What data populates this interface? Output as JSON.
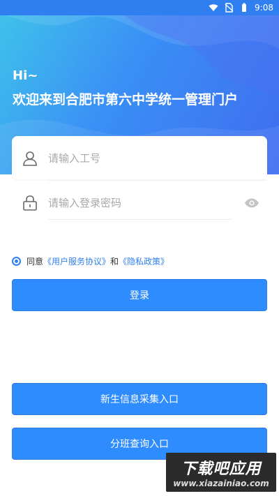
{
  "status_bar": {
    "time": "9:08"
  },
  "hero": {
    "greeting": "Hi~",
    "title": "欢迎来到合肥市第六中学统一管理门户"
  },
  "login_form": {
    "username_placeholder": "请输入工号",
    "password_placeholder": "请输入登录密码",
    "agree_prefix": "同意",
    "agree_terms": "《用户服务协议》",
    "agree_and": "和",
    "agree_privacy": "《隐私政策》",
    "login_label": "登录"
  },
  "actions": {
    "new_student_label": "新生信息采集入口",
    "class_query_label": "分班查询入口"
  },
  "watermark": {
    "brand": "下载吧应用",
    "url": "www.xiazainiao.com"
  },
  "colors": {
    "accent": "#2f8cff",
    "link": "#2f7ff0",
    "hero_start": "#3fc4ea",
    "hero_end": "#3f6cf0"
  },
  "icons": {
    "username": "user-icon",
    "password": "lock-icon",
    "toggle": "eye-icon",
    "wifi": "wifi-icon",
    "signal": "no-sim-icon",
    "battery": "battery-icon"
  }
}
